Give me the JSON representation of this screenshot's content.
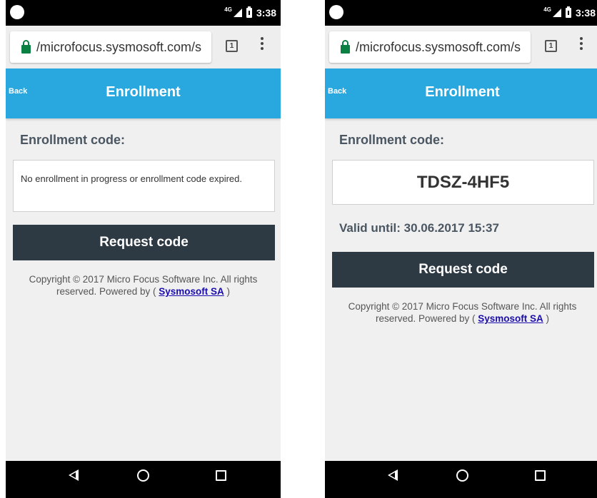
{
  "screens": [
    {
      "status_bar": {
        "network": "4G",
        "time": "3:38"
      },
      "browser": {
        "url": "/microfocus.sysmosoft.com/s",
        "tab_count": "1"
      },
      "header": {
        "back_label": "Back",
        "title": "Enrollment"
      },
      "enrollment": {
        "label": "Enrollment code:",
        "message": "No enrollment in progress or enrollment code expired."
      },
      "request_button": "Request code",
      "footer": {
        "text_before_link": "Copyright © 2017 Micro Focus Software Inc. All rights reserved. Powered by ( ",
        "link_text": "Sysmosoft SA",
        "text_after_link": " )"
      }
    },
    {
      "status_bar": {
        "network": "4G",
        "time": "3:38"
      },
      "browser": {
        "url": "/microfocus.sysmosoft.com/s",
        "tab_count": "1"
      },
      "header": {
        "back_label": "Back",
        "title": "Enrollment"
      },
      "enrollment": {
        "label": "Enrollment code:",
        "code": "TDSZ-4HF5",
        "valid_until": "Valid until: 30.06.2017 15:37"
      },
      "request_button": "Request code",
      "footer": {
        "text_before_link": "Copyright © 2017 Micro Focus Software Inc. All rights reserved. Powered by ( ",
        "link_text": "Sysmosoft SA",
        "text_after_link": " )"
      }
    }
  ],
  "colors": {
    "header": "#29a8e0",
    "button": "#2d3a44",
    "link": "#1a0dab",
    "lock": "#0b8043"
  },
  "icons": {
    "status_left": "notification-dot-icon",
    "signal": "signal-icon",
    "battery": "battery-charging-icon",
    "lock": "lock-icon",
    "tabs": "tab-switcher-icon",
    "menu": "overflow-menu-icon",
    "nav_back": "nav-back-icon",
    "nav_home": "nav-home-icon",
    "nav_recents": "nav-recents-icon"
  }
}
